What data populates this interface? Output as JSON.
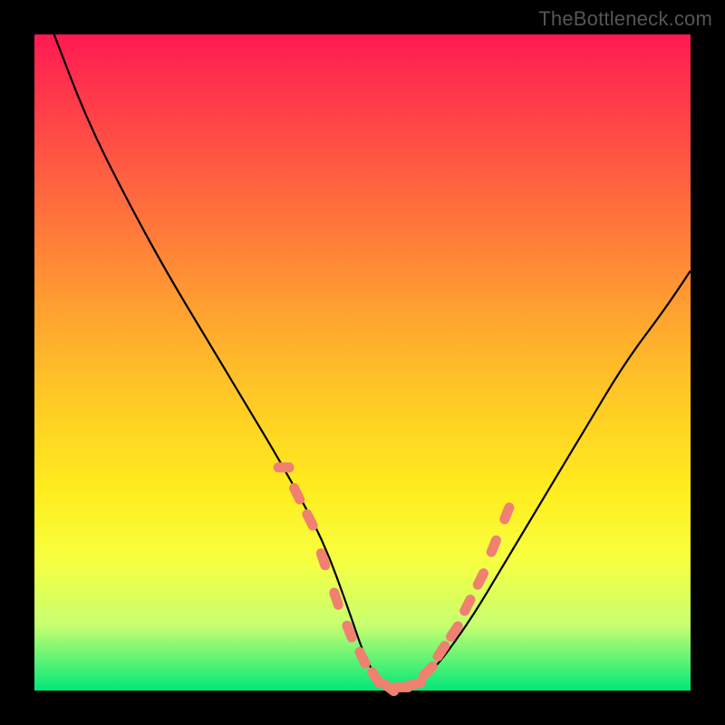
{
  "watermark": "TheBottleneck.com",
  "chart_data": {
    "type": "line",
    "title": "",
    "xlabel": "",
    "ylabel": "",
    "xlim": [
      0,
      100
    ],
    "ylim": [
      0,
      100
    ],
    "grid": false,
    "series": [
      {
        "name": "curve",
        "x": [
          3,
          8,
          14,
          20,
          26,
          32,
          38,
          44,
          48,
          50,
          52,
          54,
          56,
          60,
          66,
          72,
          78,
          84,
          90,
          96,
          100
        ],
        "y": [
          100,
          87,
          75,
          64,
          54,
          44,
          34,
          23,
          12,
          6,
          2,
          0,
          0,
          2,
          10,
          20,
          30,
          40,
          50,
          58,
          64
        ],
        "color": "#000000"
      }
    ],
    "dotted_segments": {
      "name": "highlighted-dots",
      "color": "#f08070",
      "points": [
        {
          "x": 38,
          "y": 34
        },
        {
          "x": 40,
          "y": 30
        },
        {
          "x": 42,
          "y": 26
        },
        {
          "x": 44,
          "y": 20
        },
        {
          "x": 46,
          "y": 14
        },
        {
          "x": 48,
          "y": 9
        },
        {
          "x": 50,
          "y": 5
        },
        {
          "x": 52,
          "y": 2
        },
        {
          "x": 54,
          "y": 0.5
        },
        {
          "x": 56,
          "y": 0.5
        },
        {
          "x": 58,
          "y": 1
        },
        {
          "x": 60,
          "y": 3
        },
        {
          "x": 62,
          "y": 6
        },
        {
          "x": 64,
          "y": 9
        },
        {
          "x": 66,
          "y": 13
        },
        {
          "x": 68,
          "y": 17
        },
        {
          "x": 70,
          "y": 22
        },
        {
          "x": 72,
          "y": 27
        }
      ]
    }
  }
}
